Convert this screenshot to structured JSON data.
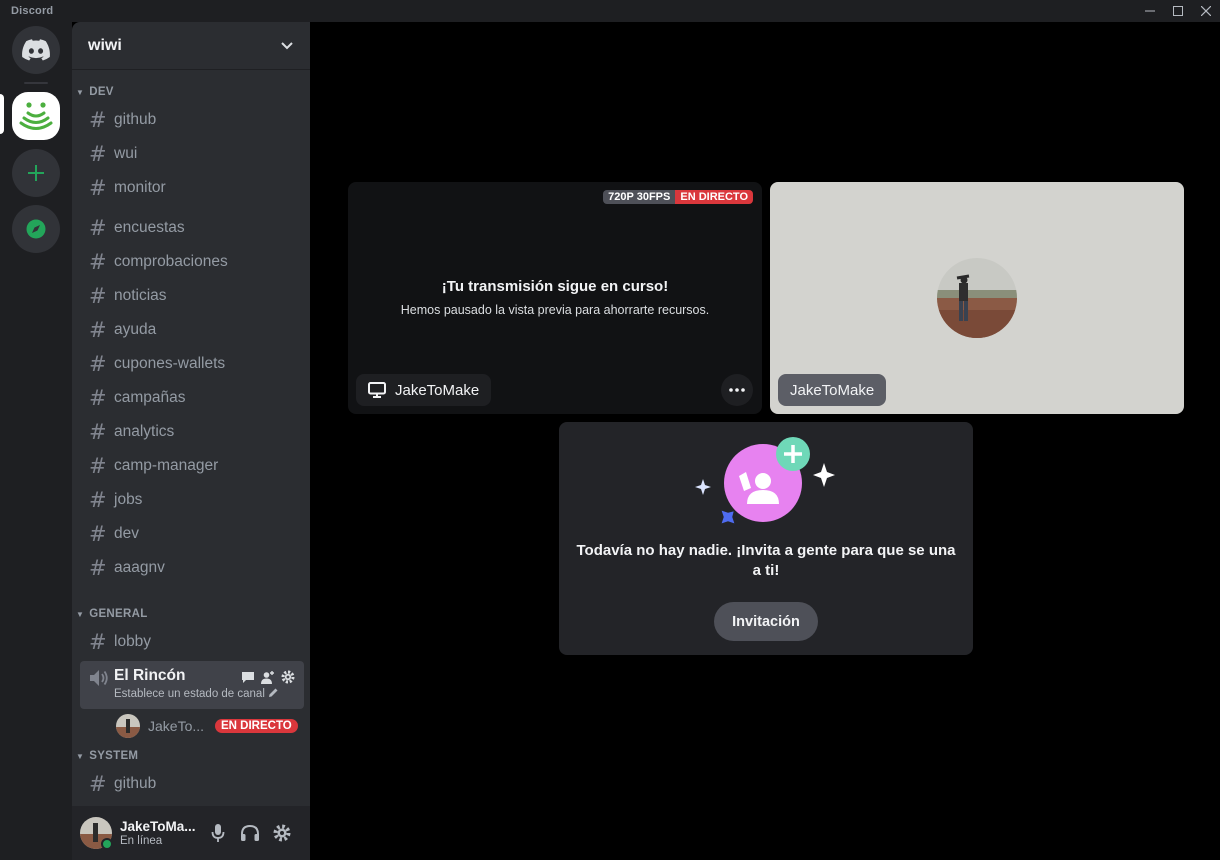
{
  "window": {
    "title": "Discord"
  },
  "rail": {
    "servers": [
      {
        "name": "Discord home",
        "icon": "discord-logo-icon"
      },
      {
        "name": "wiwi",
        "icon": "wifi-wave-icon"
      },
      {
        "name": "Add a server",
        "icon": "plus-icon"
      },
      {
        "name": "Explore",
        "icon": "compass-icon"
      }
    ]
  },
  "guild": {
    "name": "wiwi",
    "categories": [
      {
        "label": "DEV",
        "channels": [
          "github",
          "wui",
          "monitor",
          "encuestas",
          "comprobaciones",
          "noticias",
          "ayuda",
          "cupones-wallets",
          "campañas",
          "analytics",
          "camp-manager",
          "jobs",
          "dev",
          "aaagnv"
        ]
      },
      {
        "label": "GENERAL",
        "channels": [
          "lobby"
        ]
      },
      {
        "label": "SYSTEM",
        "channels": [
          "github"
        ]
      }
    ]
  },
  "voice_channel": {
    "name": "El Rincón",
    "status_placeholder": "Establece un estado de canal",
    "user": {
      "name": "JakeTo...",
      "live_badge": "EN DIRECTO"
    }
  },
  "user_panel": {
    "name": "JakeToMa...",
    "status": "En línea",
    "status_color": "#23a55a"
  },
  "stream_tile": {
    "quality": "720P 30FPS",
    "live": "EN DIRECTO",
    "title": "¡Tu transmisión sigue en curso!",
    "subtitle": "Hemos pausado la vista previa para ahorrarte recursos.",
    "user": "JakeToMake"
  },
  "camera_tile": {
    "user": "JakeToMake"
  },
  "invite_tile": {
    "message": "Todavía no hay nadie. ¡Invita a gente para que se una a ti!",
    "button": "Invitación"
  },
  "colors": {
    "live_red": "#da373c",
    "accent_green": "#23a55a",
    "invite_pink": "#e782f0",
    "invite_teal": "#6fd8b8"
  }
}
